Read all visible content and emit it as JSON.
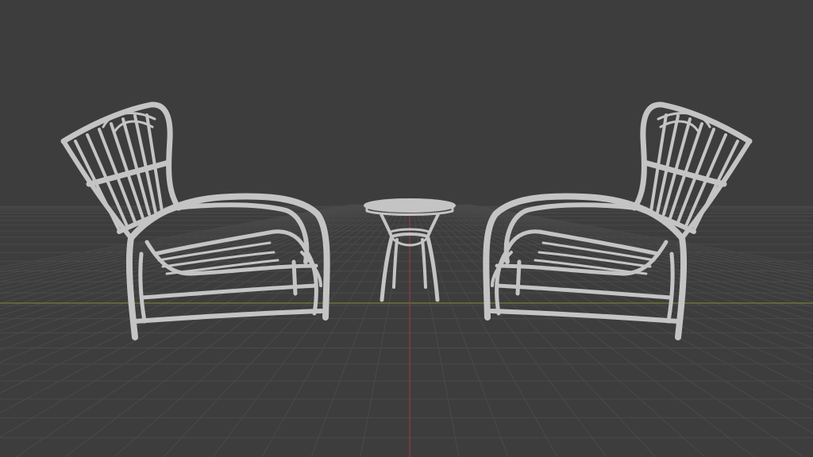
{
  "viewport": {
    "background_color": "#3d3d3d",
    "grid_color": "#4a4a4a",
    "x_axis_color": "#8a8a35",
    "y_axis_color": "#9a3a45",
    "mesh_color": "#c4c4c4"
  },
  "scene": {
    "objects": [
      {
        "name": "lounge-chair-left",
        "type": "rattan-lounge-chair"
      },
      {
        "name": "side-table",
        "type": "round-side-table"
      },
      {
        "name": "lounge-chair-right",
        "type": "rattan-lounge-chair"
      }
    ]
  }
}
